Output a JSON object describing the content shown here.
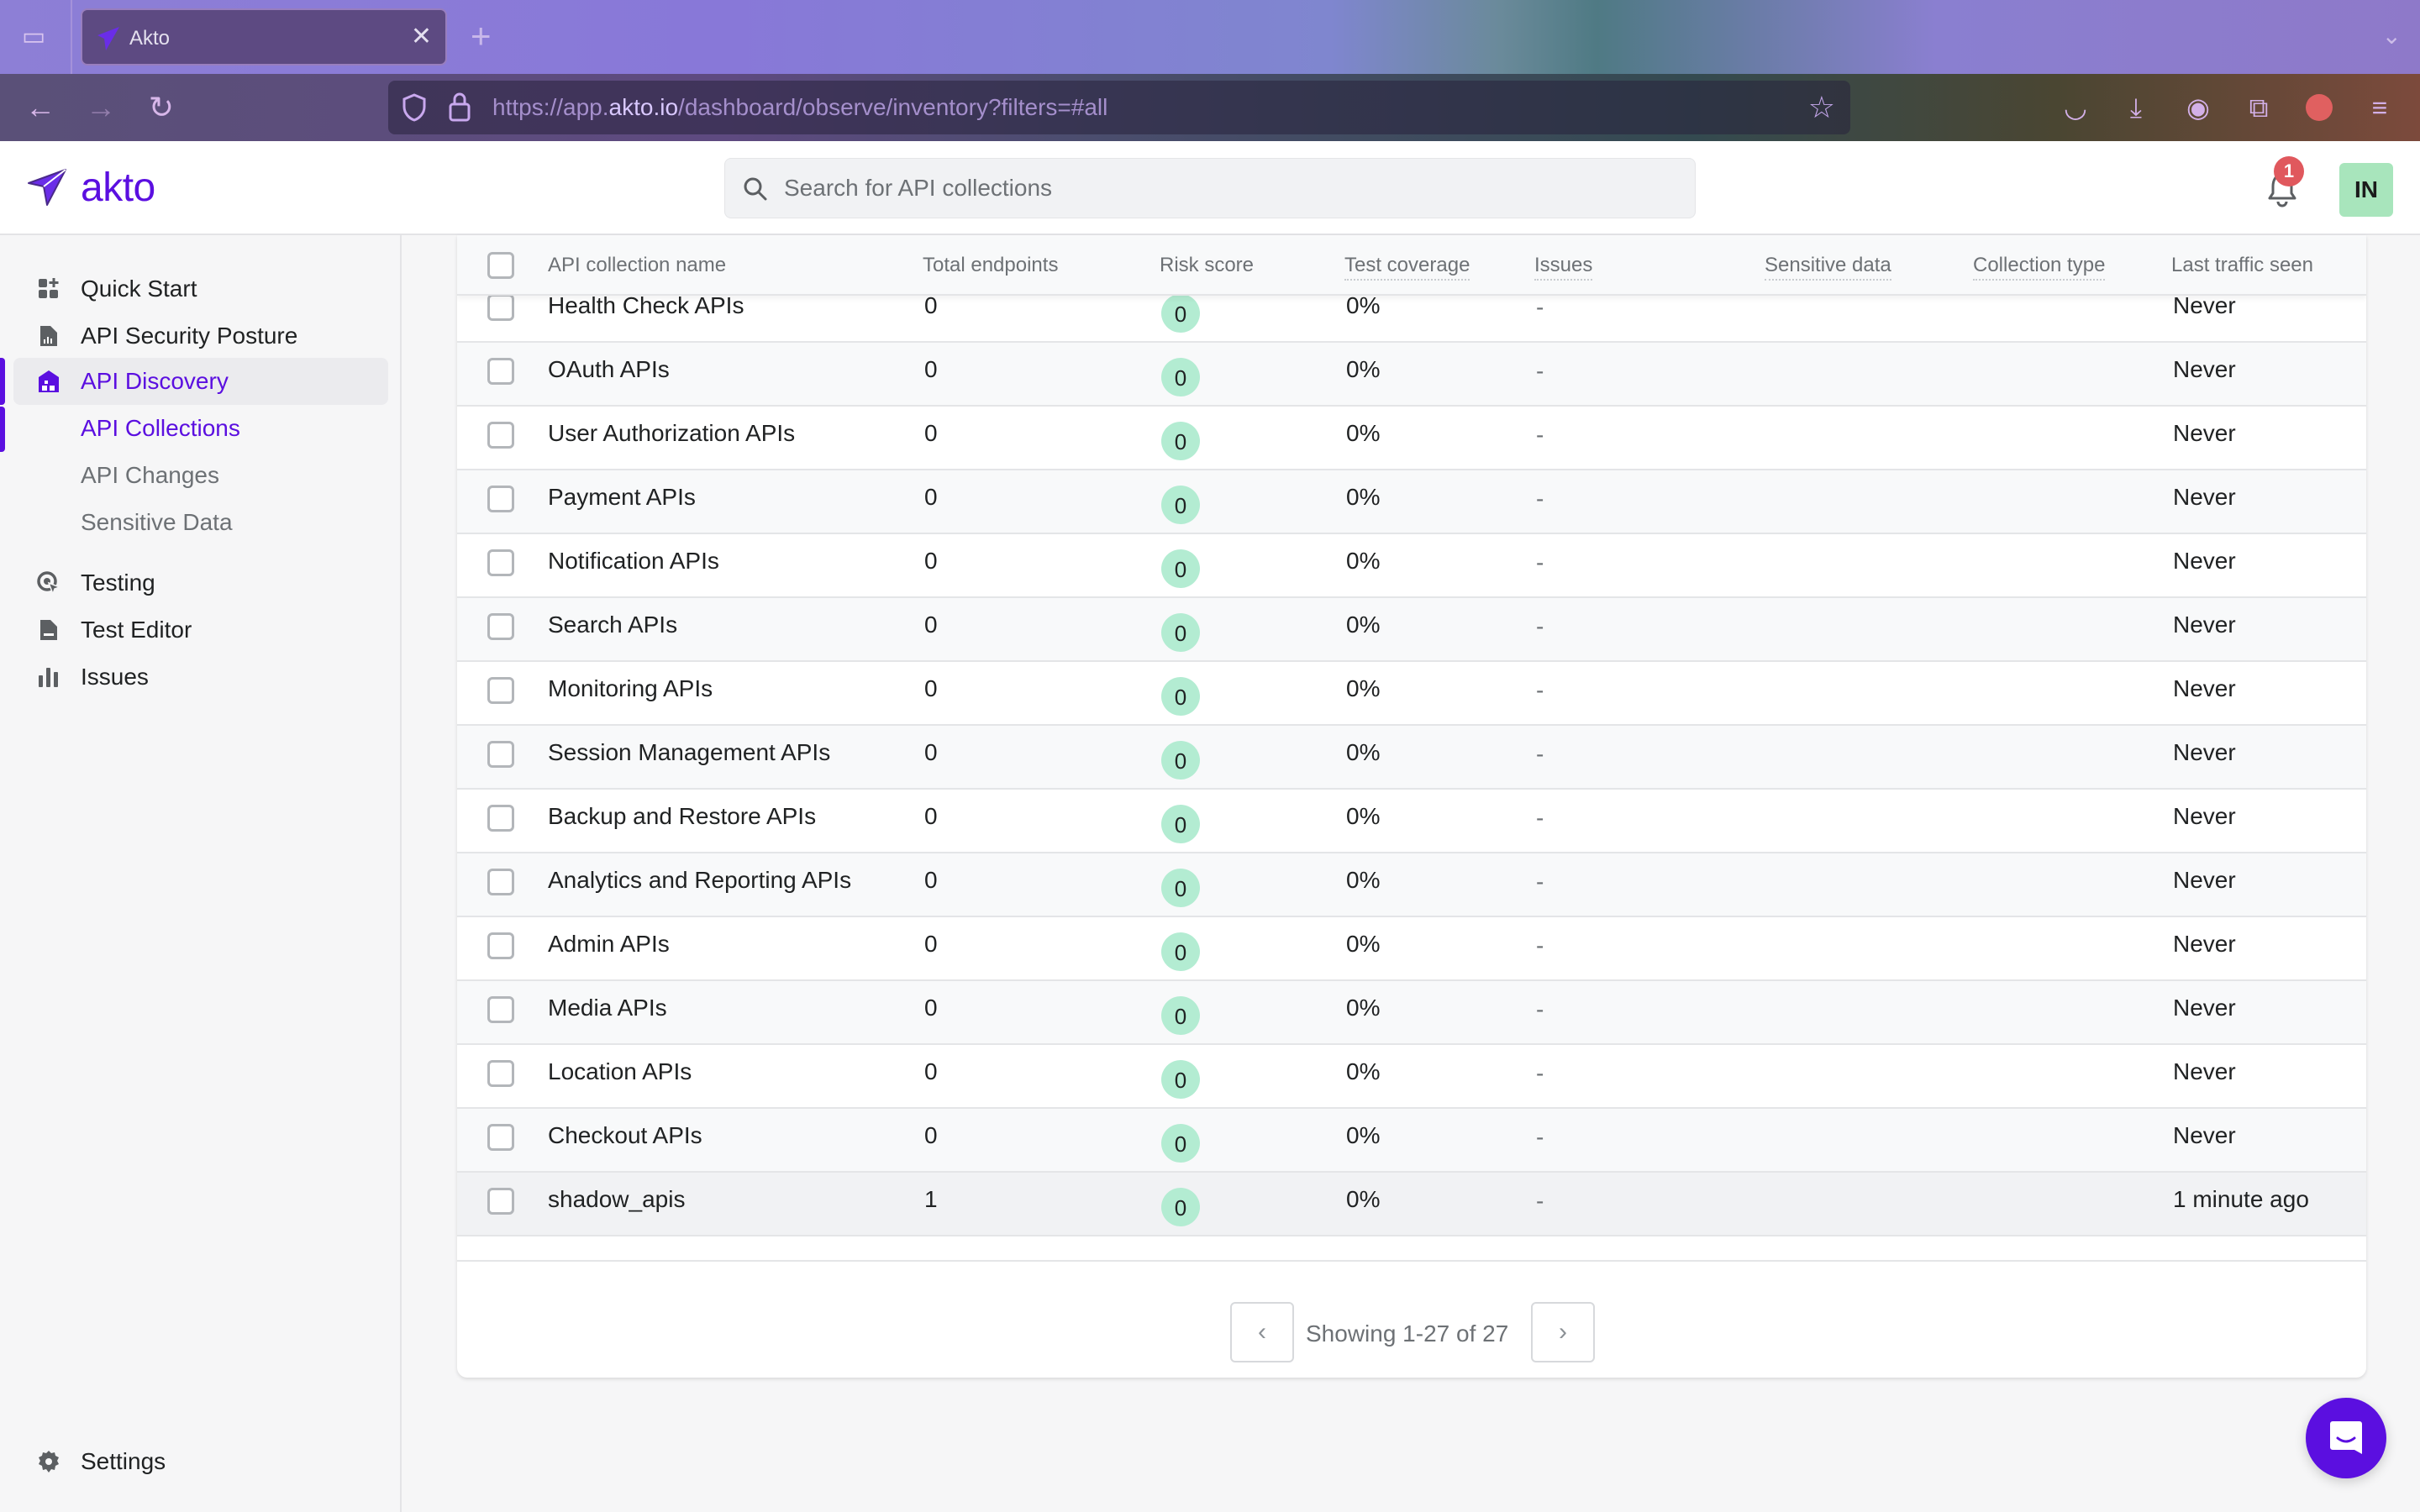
{
  "browser": {
    "tab_title": "Akto",
    "url_prefix": "https://app.",
    "url_domain": "akto.io",
    "url_path": "/dashboard/observe/inventory?filters=#all",
    "notification_badge": "1"
  },
  "header": {
    "logo_text": "akto",
    "search_placeholder": "Search for API collections",
    "notification_count": "1",
    "avatar_initials": "IN"
  },
  "sidebar": {
    "items": [
      {
        "label": "Quick Start",
        "icon": "grid-plus-icon"
      },
      {
        "label": "API Security Posture",
        "icon": "report-icon"
      },
      {
        "label": "API Discovery",
        "icon": "discovery-icon",
        "active": true
      },
      {
        "label": "Testing",
        "icon": "target-cursor-icon"
      },
      {
        "label": "Test Editor",
        "icon": "file-icon"
      },
      {
        "label": "Issues",
        "icon": "bar-chart-icon"
      }
    ],
    "subitems": [
      {
        "label": "API Collections",
        "active": true
      },
      {
        "label": "API Changes"
      },
      {
        "label": "Sensitive Data"
      }
    ],
    "settings_label": "Settings"
  },
  "table": {
    "columns": [
      "API collection name",
      "Total endpoints",
      "Risk score",
      "Test coverage",
      "Issues",
      "Sensitive data",
      "Collection type",
      "Last traffic seen"
    ],
    "rows": [
      {
        "name": "Health Check APIs",
        "endpoints": "0",
        "risk": "0",
        "coverage": "0%",
        "issues": "-",
        "sensitive": "",
        "type": "",
        "last_seen": "Never"
      },
      {
        "name": "OAuth APIs",
        "endpoints": "0",
        "risk": "0",
        "coverage": "0%",
        "issues": "-",
        "sensitive": "",
        "type": "",
        "last_seen": "Never"
      },
      {
        "name": "User Authorization APIs",
        "endpoints": "0",
        "risk": "0",
        "coverage": "0%",
        "issues": "-",
        "sensitive": "",
        "type": "",
        "last_seen": "Never"
      },
      {
        "name": "Payment APIs",
        "endpoints": "0",
        "risk": "0",
        "coverage": "0%",
        "issues": "-",
        "sensitive": "",
        "type": "",
        "last_seen": "Never"
      },
      {
        "name": "Notification APIs",
        "endpoints": "0",
        "risk": "0",
        "coverage": "0%",
        "issues": "-",
        "sensitive": "",
        "type": "",
        "last_seen": "Never"
      },
      {
        "name": "Search APIs",
        "endpoints": "0",
        "risk": "0",
        "coverage": "0%",
        "issues": "-",
        "sensitive": "",
        "type": "",
        "last_seen": "Never"
      },
      {
        "name": "Monitoring APIs",
        "endpoints": "0",
        "risk": "0",
        "coverage": "0%",
        "issues": "-",
        "sensitive": "",
        "type": "",
        "last_seen": "Never"
      },
      {
        "name": "Session Management APIs",
        "endpoints": "0",
        "risk": "0",
        "coverage": "0%",
        "issues": "-",
        "sensitive": "",
        "type": "",
        "last_seen": "Never"
      },
      {
        "name": "Backup and Restore APIs",
        "endpoints": "0",
        "risk": "0",
        "coverage": "0%",
        "issues": "-",
        "sensitive": "",
        "type": "",
        "last_seen": "Never"
      },
      {
        "name": "Analytics and Reporting APIs",
        "endpoints": "0",
        "risk": "0",
        "coverage": "0%",
        "issues": "-",
        "sensitive": "",
        "type": "",
        "last_seen": "Never"
      },
      {
        "name": "Admin APIs",
        "endpoints": "0",
        "risk": "0",
        "coverage": "0%",
        "issues": "-",
        "sensitive": "",
        "type": "",
        "last_seen": "Never"
      },
      {
        "name": "Media APIs",
        "endpoints": "0",
        "risk": "0",
        "coverage": "0%",
        "issues": "-",
        "sensitive": "",
        "type": "",
        "last_seen": "Never"
      },
      {
        "name": "Location APIs",
        "endpoints": "0",
        "risk": "0",
        "coverage": "0%",
        "issues": "-",
        "sensitive": "",
        "type": "",
        "last_seen": "Never"
      },
      {
        "name": "Checkout APIs",
        "endpoints": "0",
        "risk": "0",
        "coverage": "0%",
        "issues": "-",
        "sensitive": "",
        "type": "",
        "last_seen": "Never"
      },
      {
        "name": "shadow_apis",
        "endpoints": "1",
        "risk": "0",
        "coverage": "0%",
        "issues": "-",
        "sensitive": "",
        "type": "",
        "last_seen": "1 minute ago"
      }
    ]
  },
  "pagination": {
    "label": "Showing 1-27 of 27",
    "prev_icon": "chevron-left-icon",
    "next_icon": "chevron-right-icon"
  },
  "colors": {
    "brand": "#5b0fe0",
    "risk_low": "#b3ecd2",
    "avatar_bg": "#a8e5bc",
    "badge": "#e0585d"
  }
}
